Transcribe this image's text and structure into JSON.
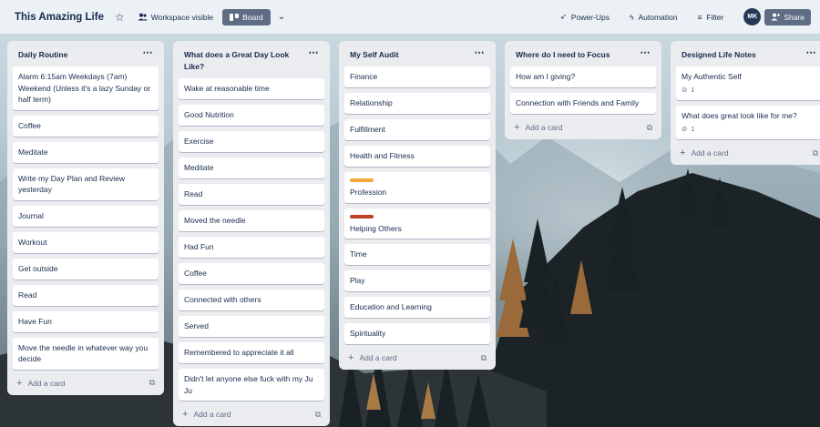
{
  "header": {
    "board_title": "This Amazing Life",
    "visibility": "Workspace visible",
    "view": "Board",
    "powerups": "Power-Ups",
    "automation": "Automation",
    "filter": "Filter",
    "avatar_initials": "MK",
    "share": "Share"
  },
  "icons": {
    "star": "star-icon",
    "visibility": "people-icon",
    "board": "board-icon",
    "view_switch": "chevron-down-icon",
    "powerups": "rocket-icon",
    "automation": "lightning-icon",
    "filter": "filter-icon",
    "share": "person-add-icon",
    "list_menu": "more-icon",
    "attachment": "paperclip-icon",
    "add": "plus-icon",
    "template": "card-template-icon"
  },
  "colors": {
    "label_orange": "#f0a53f",
    "label_red": "#c0412b",
    "board_button": "#5e6c84"
  },
  "add_card_label": "Add a card",
  "lists": [
    {
      "title": "Daily Routine",
      "cards": [
        {
          "text": "Alarm 6:15am Weekdays (7am) Weekend (Unless it's a lazy Sunday or half term)"
        },
        {
          "text": "Coffee"
        },
        {
          "text": "Meditate"
        },
        {
          "text": "Write my Day Plan and Review yesterday"
        },
        {
          "text": "Journal"
        },
        {
          "text": "Workout"
        },
        {
          "text": "Get outside"
        },
        {
          "text": "Read"
        },
        {
          "text": "Have Fun"
        },
        {
          "text": "Move the needle in whatever way you decide"
        }
      ]
    },
    {
      "title": "What does a Great Day Look Like?",
      "cards": [
        {
          "text": "Wake at reasonable time"
        },
        {
          "text": "Good Nutrition"
        },
        {
          "text": "Exercise"
        },
        {
          "text": "Meditate"
        },
        {
          "text": "Read"
        },
        {
          "text": "Moved the needle"
        },
        {
          "text": "Had Fun"
        },
        {
          "text": "Coffee"
        },
        {
          "text": "Connected with others"
        },
        {
          "text": "Served"
        },
        {
          "text": "Remembered to appreciate it all"
        },
        {
          "text": "Didn't let anyone else fuck with my Ju Ju"
        }
      ]
    },
    {
      "title": "My Self Audit",
      "cards": [
        {
          "text": "Finance"
        },
        {
          "text": "Relationship"
        },
        {
          "text": "Fulfillment"
        },
        {
          "text": "Health and Fitness"
        },
        {
          "text": "Profession",
          "label": "#f0a53f"
        },
        {
          "text": "Helping Others",
          "label": "#c0412b"
        },
        {
          "text": "Time"
        },
        {
          "text": "Play"
        },
        {
          "text": "Education and Learning"
        },
        {
          "text": "Spirituality"
        }
      ]
    },
    {
      "title": "Where do I need to Focus",
      "cards": [
        {
          "text": "How am I giving?"
        },
        {
          "text": "Connection with Friends and Family"
        }
      ]
    },
    {
      "title": "Designed Life Notes",
      "cards": [
        {
          "text": "My Authentic Self",
          "attachments": "1"
        },
        {
          "text": "What does great look like for me?",
          "attachments": "1"
        }
      ]
    }
  ]
}
